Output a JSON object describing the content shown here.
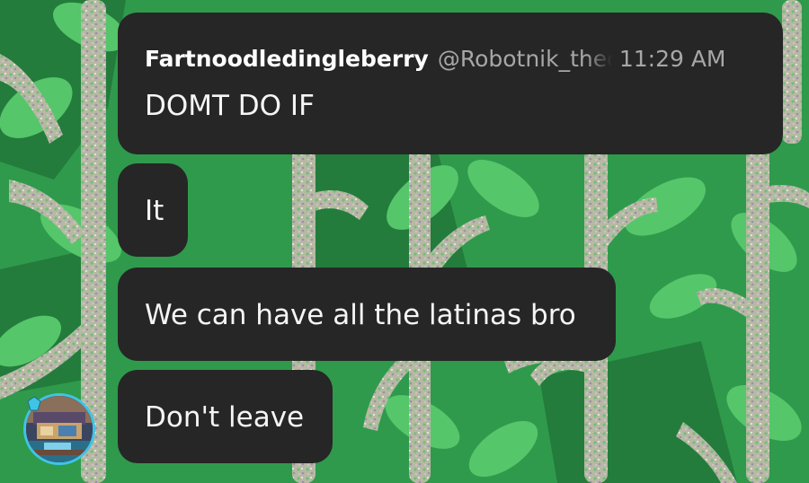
{
  "conversation": {
    "sender": {
      "name": "Fartnoodledingleberry",
      "handle": "@Robotnik_thedog",
      "time": "11:29 AM"
    },
    "messages": [
      {
        "text": "DOMT DO IF"
      },
      {
        "text": "It"
      },
      {
        "text": "We can have all the latinas bro"
      },
      {
        "text": "Don't leave"
      }
    ]
  },
  "theme": {
    "background": "#2f9a4c",
    "bubble": "#262626",
    "avatar_ring": "#3fc4e6"
  },
  "icons": {
    "avatar": "user-avatar-icon",
    "avatar_badge": "badge-icon"
  }
}
